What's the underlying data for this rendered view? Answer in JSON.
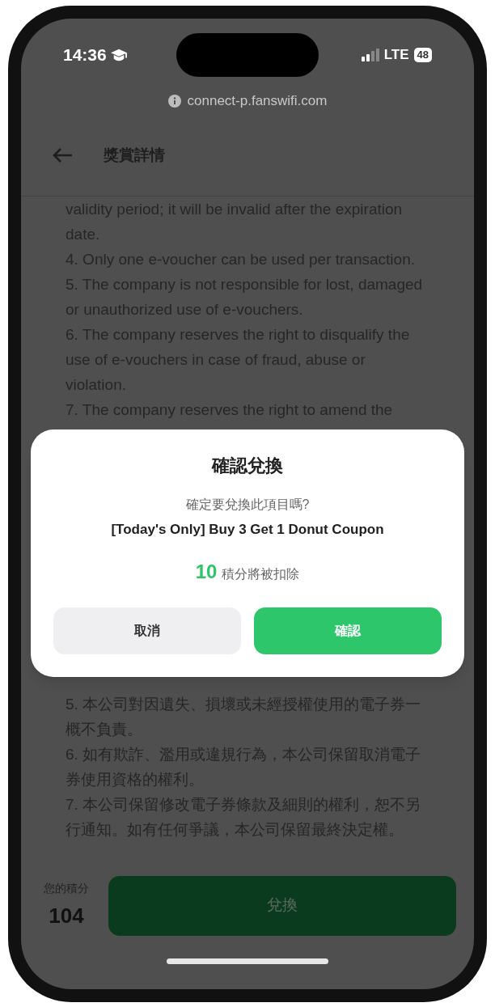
{
  "status_bar": {
    "time": "14:36",
    "network": "LTE",
    "battery": "48"
  },
  "browser": {
    "url": "connect-p.fanswifi.com"
  },
  "header": {
    "title": "獎賞詳情"
  },
  "terms_en": [
    "validity period; it will be invalid after the expiration date.",
    "4. Only one e-voucher can be used per transaction.",
    "5. The company is not responsible for lost, damaged or unauthorized use of e-vouchers.",
    "6. The company reserves the right to disqualify the use of e-vouchers in case of fraud, abuse or violation.",
    "7. The company reserves the right to amend the"
  ],
  "terms_zh": [
    "5. 本公司對因遺失、損壞或未經授權使用的電子券一概不負責。",
    "6. 如有欺詐、濫用或違規行為，本公司保留取消電子券使用資格的權利。",
    "7. 本公司保留修改電子券條款及細則的權利，恕不另行通知。如有任何爭議，本公司保留最終決定權。"
  ],
  "dialog": {
    "title": "確認兌換",
    "question": "確定要兌換此項目嗎?",
    "item_name": "[Today's Only] Buy 3 Get 1 Donut Coupon",
    "points": "10",
    "points_note": "積分將被扣除",
    "buttons": [
      {
        "label": "取消",
        "kind": "secondary"
      },
      {
        "label": "確認",
        "kind": "primary"
      }
    ]
  },
  "footer": {
    "points_label": "您的積分",
    "points": "104",
    "redeem_button": "兌換"
  }
}
